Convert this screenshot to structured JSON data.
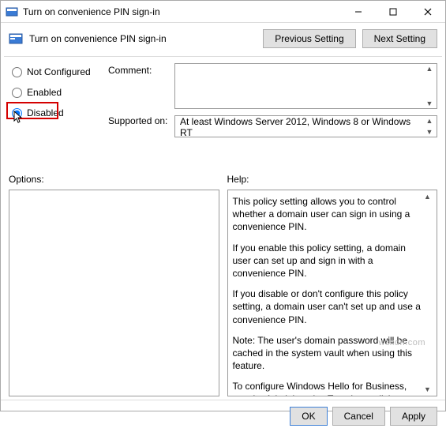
{
  "window": {
    "title": "Turn on convenience PIN sign-in"
  },
  "header": {
    "title": "Turn on convenience PIN sign-in",
    "previous": "Previous Setting",
    "next": "Next Setting"
  },
  "radios": {
    "not_configured": "Not Configured",
    "enabled": "Enabled",
    "disabled": "Disabled",
    "selected": "disabled"
  },
  "labels": {
    "comment": "Comment:",
    "supported": "Supported on:",
    "options": "Options:",
    "help": "Help:"
  },
  "comment_text": "",
  "supported_text": "At least Windows Server 2012, Windows 8 or Windows RT",
  "help": {
    "p1": "This policy setting allows you to control whether a domain user can sign in using a convenience PIN.",
    "p2": "If you enable this policy setting, a domain user can set up and sign in with a convenience PIN.",
    "p3": "If you disable or don't configure this policy setting, a domain user can't set up and use a convenience PIN.",
    "p4": "Note: The user's domain password will be cached in the system vault when using this feature.",
    "p5": "To configure Windows Hello for Business, use the Administrative Template policies under Windows Hello for Business."
  },
  "footer": {
    "ok": "OK",
    "cancel": "Cancel",
    "apply": "Apply"
  },
  "watermark": "wsxdn.com"
}
